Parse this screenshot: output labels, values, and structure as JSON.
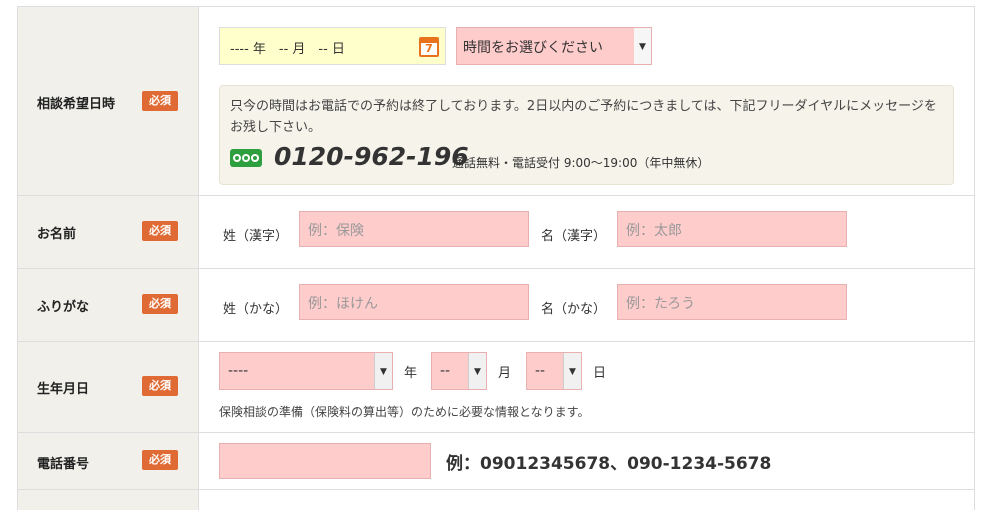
{
  "required_badge": "必須",
  "rows": {
    "datetime": {
      "label": "相談希望日時",
      "date_placeholder": "---- 年　-- 月　-- 日",
      "calendar_day": "7",
      "time_select": "時間をお選びください",
      "notice": "只今の時間はお電話での予約は終了しております。2日以内のご予約につきましては、下記フリーダイヤルにメッセージをお残し下さい。",
      "phone": "0120-962-196",
      "phone_note": "通話無料・電話受付 9:00〜19:00（年中無休）"
    },
    "name": {
      "label": "お名前",
      "last_label": "姓（漢字）",
      "last_placeholder": "例：保険",
      "first_label": "名（漢字）",
      "first_placeholder": "例：太郎"
    },
    "kana": {
      "label": "ふりがな",
      "last_label": "姓（かな）",
      "last_placeholder": "例：ほけん",
      "first_label": "名（かな）",
      "first_placeholder": "例：たろう"
    },
    "birthday": {
      "label": "生年月日",
      "year_value": "----",
      "year_unit": "年",
      "month_value": "--",
      "month_unit": "月",
      "day_value": "--",
      "day_unit": "日",
      "note": "保険相談の準備（保険料の算出等）のために必要な情報となります。"
    },
    "phone": {
      "label": "電話番号",
      "example": "例：09012345678、090-1234-5678"
    }
  }
}
